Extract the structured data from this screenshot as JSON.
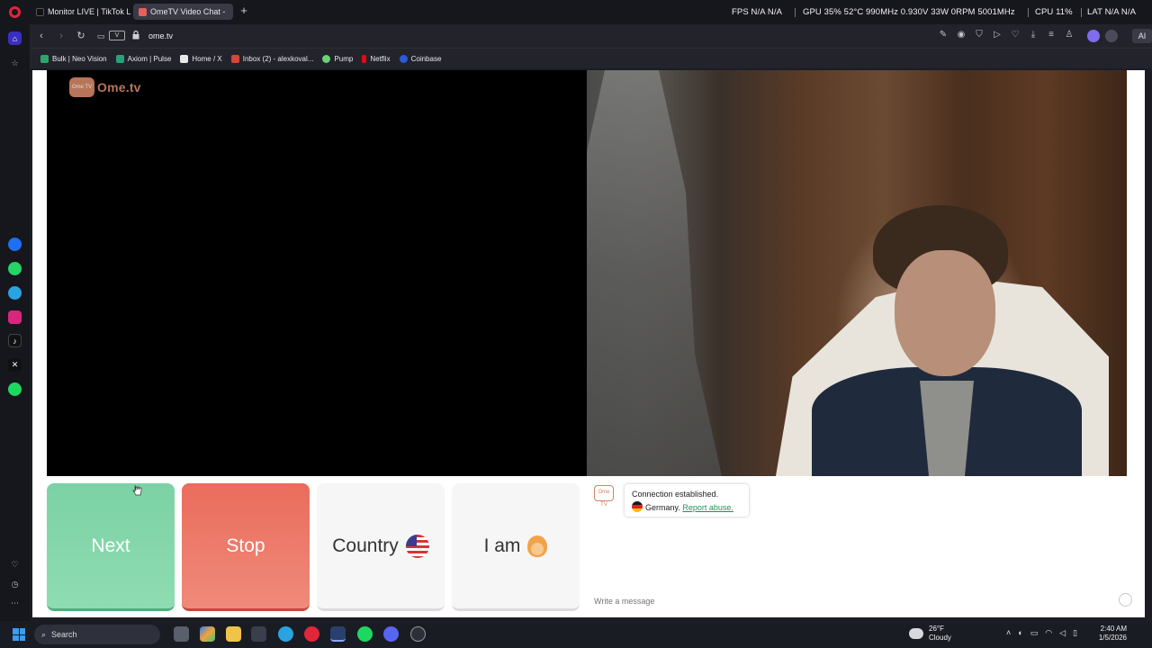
{
  "tabs": [
    {
      "label": "Monitor LIVE | TikTok LIVE",
      "color": "#111111"
    },
    {
      "label": "OmeTV Video Chat -",
      "color": "#e8605a"
    }
  ],
  "hud": {
    "fps": "FPS N/A N/A",
    "gpu": "GPU 35% 52°C 990MHz 0.930V 33W 0RPM 5001MHz",
    "cpu": "CPU 11%",
    "lat": "LAT N/A N/A"
  },
  "address": {
    "url": "ome.tv",
    "vpn": "V"
  },
  "ai_label": "AI",
  "bookmarks": [
    {
      "label": "Bulk | Neo Vision",
      "color": "#2fa46a"
    },
    {
      "label": "Axiom | Pulse",
      "color": "#27a17a"
    },
    {
      "label": "Home / X",
      "color": "#e8e8e8"
    },
    {
      "label": "Inbox (2) - alexkoval...",
      "color": "#d44638"
    },
    {
      "label": "Pump",
      "color": "#69d17a"
    },
    {
      "label": "Netflix",
      "color": "#e50914"
    },
    {
      "label": "Coinbase",
      "color": "#2a5bd7"
    }
  ],
  "logo": {
    "tv": "Ome TV",
    "text": "Ome.tv"
  },
  "controls": {
    "next": "Next",
    "stop": "Stop",
    "country": "Country",
    "iam": "I am"
  },
  "chat": {
    "avatar": "Ome TV",
    "line1": "Connection established.",
    "country": "Germany.",
    "report": "Report abuse.",
    "placeholder": "Write a message"
  },
  "taskbar": {
    "search": "Search",
    "temp": "26°F",
    "weather": "Cloudy",
    "time": "2:40 AM",
    "date": "1/5/2026"
  },
  "colors": {
    "next": "#7bd2a4",
    "stop": "#ea6c5c",
    "brand": "#d98a69"
  }
}
